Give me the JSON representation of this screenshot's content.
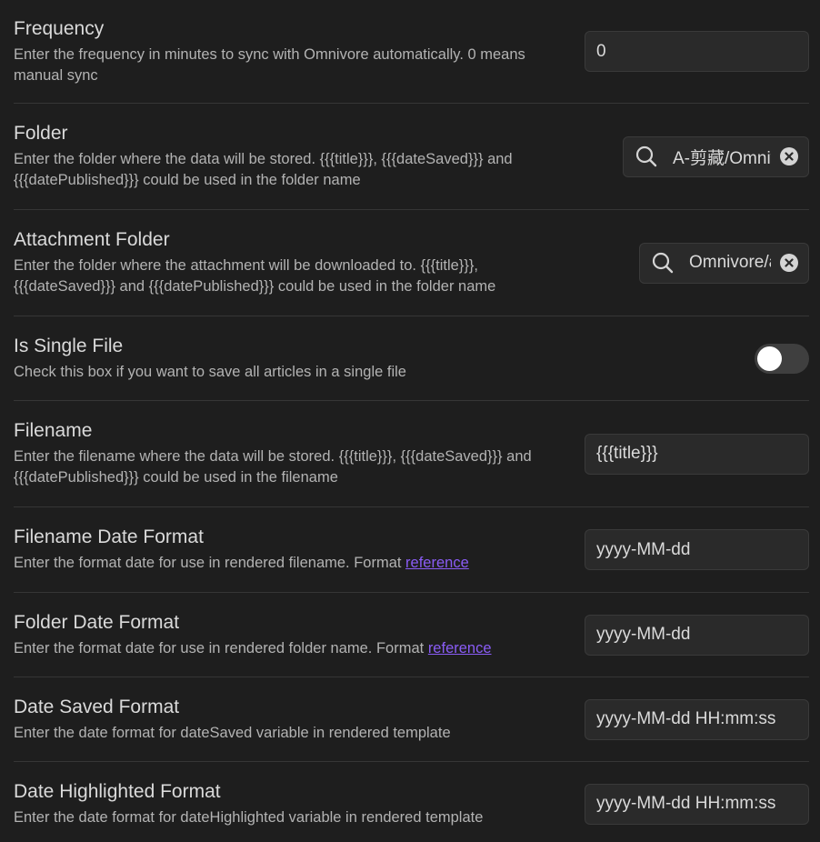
{
  "settings": [
    {
      "key": "frequency",
      "name": "Frequency",
      "desc": "Enter the frequency in minutes to sync with Omnivore automatically. 0 means manual sync",
      "value": "0"
    },
    {
      "key": "folder",
      "name": "Folder",
      "desc": "Enter the folder where the data will be stored. {{{title}}}, {{{dateSaved}}} and {{{datePublished}}} could be used in the folder name",
      "value": "A-剪藏/Omnivore"
    },
    {
      "key": "attachment_folder",
      "name": "Attachment Folder",
      "desc": "Enter the folder where the attachment will be downloaded to. {{{title}}}, {{{dateSaved}}} and {{{datePublished}}} could be used in the folder name",
      "value": "Omnivore/attachments"
    },
    {
      "key": "is_single_file",
      "name": "Is Single File",
      "desc": "Check this box if you want to save all articles in a single file",
      "enabled": false
    },
    {
      "key": "filename",
      "name": "Filename",
      "desc": "Enter the filename where the data will be stored. {{{title}}}, {{{dateSaved}}} and {{{datePublished}}} could be used in the filename",
      "value": "{{{title}}}"
    },
    {
      "key": "filename_date_format",
      "name": "Filename Date Format",
      "desc": "Enter the format date for use in rendered filename. Format ",
      "link": "reference",
      "value": "yyyy-MM-dd"
    },
    {
      "key": "folder_date_format",
      "name": "Folder Date Format",
      "desc": "Enter the format date for use in rendered folder name. Format ",
      "link": "reference",
      "value": "yyyy-MM-dd"
    },
    {
      "key": "date_saved_format",
      "name": "Date Saved Format",
      "desc": "Enter the date format for dateSaved variable in rendered template",
      "value": "yyyy-MM-dd HH:mm:ss"
    },
    {
      "key": "date_highlighted_format",
      "name": "Date Highlighted Format",
      "desc": "Enter the date format for dateHighlighted variable in rendered template",
      "value": "yyyy-MM-dd HH:mm:ss"
    }
  ],
  "colors": {
    "background": "#1e1e1e",
    "link": "#8a5cf5",
    "input_bg": "#2a2a2a",
    "toggle_off": "#3f3f3f"
  },
  "icons": {
    "search": "search-icon",
    "clear": "clear-icon"
  }
}
